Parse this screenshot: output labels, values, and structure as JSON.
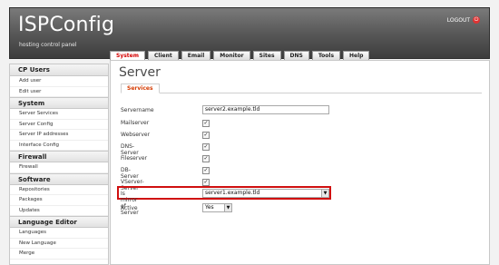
{
  "header": {
    "logo": "ISPConfig",
    "tagline": "hosting control panel",
    "logout_label": "LOGOUT",
    "logout_icon": "power-icon"
  },
  "tabs": [
    {
      "label": "System",
      "active": true
    },
    {
      "label": "Client"
    },
    {
      "label": "Email"
    },
    {
      "label": "Monitor"
    },
    {
      "label": "Sites"
    },
    {
      "label": "DNS"
    },
    {
      "label": "Tools"
    },
    {
      "label": "Help"
    }
  ],
  "sidebar": {
    "sections": [
      {
        "title": "CP Users",
        "items": [
          "Add user",
          "Edit user"
        ]
      },
      {
        "title": "System",
        "items": [
          "Server Services",
          "Server Config",
          "Server IP addresses",
          "Interface Config"
        ]
      },
      {
        "title": "Firewall",
        "items": [
          "Firewall"
        ]
      },
      {
        "title": "Software",
        "items": [
          "Repositories",
          "Packages",
          "Updates"
        ]
      },
      {
        "title": "Language Editor",
        "items": [
          "Languages",
          "New Language",
          "Merge"
        ]
      }
    ]
  },
  "main": {
    "title": "Server",
    "subtab": "Services",
    "fields": {
      "servername_label": "Servername",
      "servername_value": "server2.example.tld",
      "mailserver_label": "Mailserver",
      "webserver_label": "Webserver",
      "dnsserver_label": "DNS-Server",
      "fileserver_label": "Fileserver",
      "dbserver_label": "DB-Server",
      "vserver_label": "VServer-Server",
      "mirror_label": "Is mirror of Server",
      "mirror_value": "server1.example.tld",
      "active_label": "Active",
      "active_value": "Yes"
    },
    "checked_mark": "✓",
    "dropdown_arrow": "▼",
    "highlight_color": "#d01010"
  }
}
